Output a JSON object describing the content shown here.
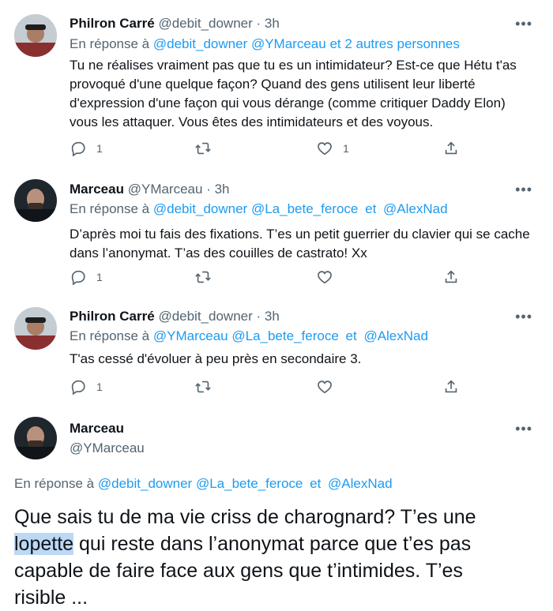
{
  "tweets": [
    {
      "name": "Philron Carré",
      "handle": "@debit_downer",
      "time": "· 3h",
      "reply_prefix": "En réponse à",
      "reply_users": [
        "@debit_downer",
        "@YMarceau",
        "et 2 autres personnes"
      ],
      "text": "Tu ne réalises vraiment pas que tu es un intimidateur? Est-ce que Hétu t'as provoqué d'une quelque façon? Quand des gens utilisent leur liberté d'expression d'une façon qui vous dérange (comme critiquer Daddy Elon) vous les attaquer. Vous êtes des intimidateurs et des voyous.",
      "reply_count": "1",
      "like_count": "1"
    },
    {
      "name": "Marceau",
      "handle": "@YMarceau",
      "time": "· 3h",
      "reply_prefix": "En réponse à",
      "reply_users": [
        "@debit_downer",
        "@La_bete_feroce",
        "et",
        "@AlexNad"
      ],
      "text": "D’après moi tu fais des fixations. T’es un petit guerrier du clavier qui se cache dans l’anonymat. T’as des couilles de castrato! Xx",
      "reply_count": "1"
    },
    {
      "name": "Philron Carré",
      "handle": "@debit_downer",
      "time": "· 3h",
      "reply_prefix": "En réponse à",
      "reply_users": [
        "@YMarceau",
        "@La_bete_feroce",
        "et",
        "@AlexNad"
      ],
      "text": "T'as cessé d'évoluer à peu près en secondaire 3.",
      "reply_count": "1"
    }
  ],
  "main_tweet": {
    "name": "Marceau",
    "handle": "@YMarceau",
    "reply_prefix": "En réponse à",
    "reply_users": [
      "@debit_downer",
      "@La_bete_feroce",
      "et",
      "@AlexNad"
    ],
    "text_before": "Que sais tu de ma vie criss de charognard? T’es une ",
    "text_highlight": "lopette",
    "text_after": " qui reste dans l’anonymat parce que t’es pas capable de faire face aux gens que t’intimides. T’es risible ..."
  },
  "more_label": "•••",
  "icons": [
    "reply-icon",
    "retweet-icon",
    "like-icon",
    "share-icon",
    "more-icon"
  ],
  "colors": {
    "link": "#1d9bf0",
    "muted": "#536471",
    "text": "#0f1419",
    "highlight": "#bcd8f5"
  }
}
